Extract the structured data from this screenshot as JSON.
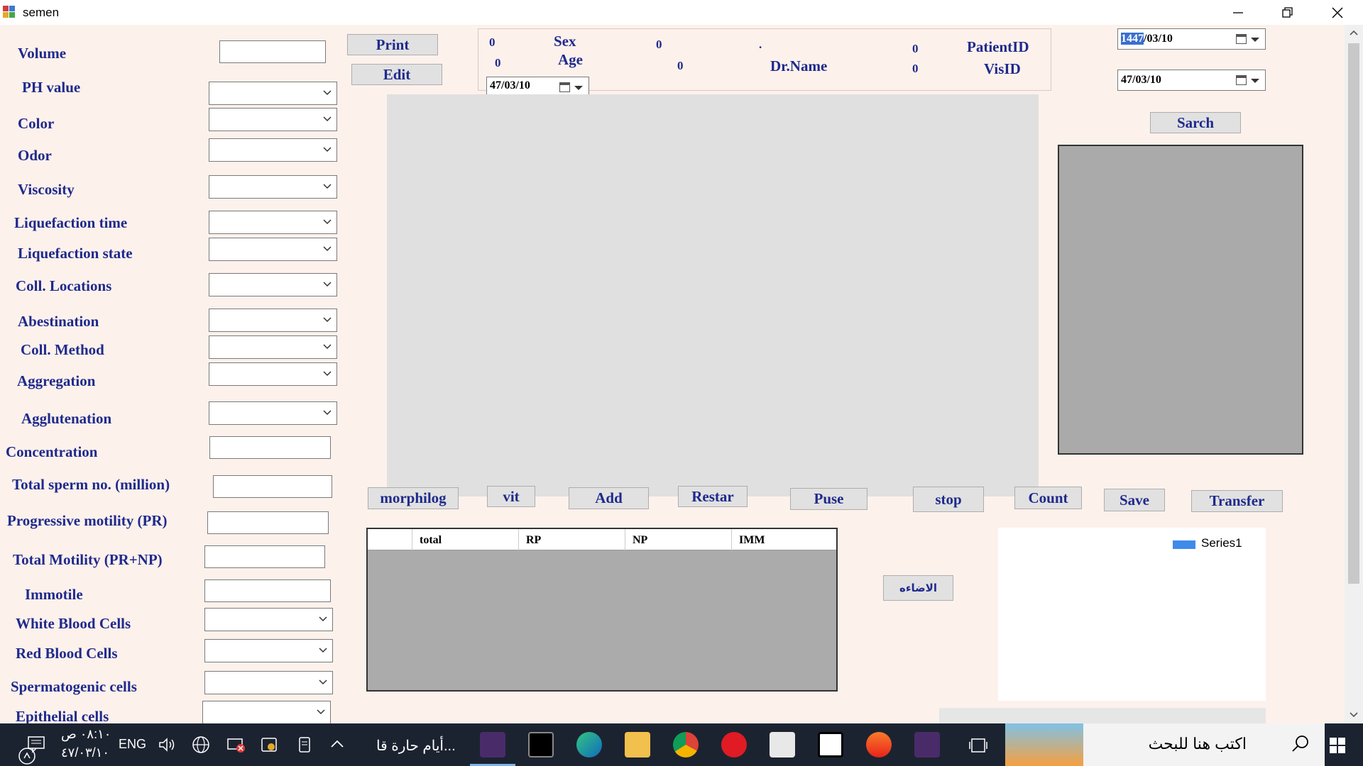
{
  "window": {
    "title": "semen"
  },
  "form": {
    "labels": {
      "volume": "Volume",
      "ph": "PH value",
      "color": "Color",
      "odor": "Odor",
      "viscosity": "Viscosity",
      "liq_time": "Liquefaction time",
      "liq_state": "Liquefaction state",
      "coll_loc": "Coll. Locations",
      "abestination": "Abestination",
      "coll_method": "Coll. Method",
      "aggregation": "Aggregation",
      "agglutenation": "Agglutenation",
      "concentration": "Concentration",
      "total_sperm": "Total sperm no. (million)",
      "prog_motility": "Progressive motility (PR)",
      "total_motility": "Total Motility (PR+NP)",
      "immotile": "Immotile",
      "wbc": "White Blood Cells",
      "rbc": "Red Blood Cells",
      "spermatogenic": "Spermatogenic cells",
      "epithelial": "Epithelial cells"
    }
  },
  "buttons": {
    "print": "Print",
    "edit": "Edit",
    "search": "Sarch",
    "morphology": "morphilog",
    "vit": "vit",
    "add": "Add",
    "restart": "Restar",
    "pause": "Puse",
    "stop": "stop",
    "count": "Count",
    "save": "Save",
    "transfer": "Transfer",
    "lighting": "الاضاءه"
  },
  "patient_info": {
    "sex_label": "Sex",
    "age_label": "Age",
    "drname_label": "Dr.Name",
    "patientid_label": "PatientID",
    "visid_label": "VisID",
    "v1": "0",
    "v2": "0",
    "v3": "0",
    "v4": "0",
    "v5": "0",
    "v6": "0",
    "dot": ".",
    "date": "47/03/10"
  },
  "date_range": {
    "from_year_selected": "1447",
    "from_rest": "/03/10",
    "to": "47/03/10"
  },
  "grid": {
    "columns": [
      "total",
      "RP",
      "NP",
      "IMM"
    ]
  },
  "chart_data": {
    "type": "bar",
    "series": [
      {
        "name": "Series1",
        "values": []
      }
    ]
  },
  "taskbar": {
    "search_placeholder": "اكتب هنا للبحث",
    "window_title": "أيام حارة قا...",
    "language": "ENG",
    "time": "٠٨:١٠ ص",
    "date": "٤٧/٠٣/١٠"
  },
  "colors": {
    "label": "#1f2a8c",
    "background": "#fdf1ec",
    "legend": "#3f8bea"
  }
}
